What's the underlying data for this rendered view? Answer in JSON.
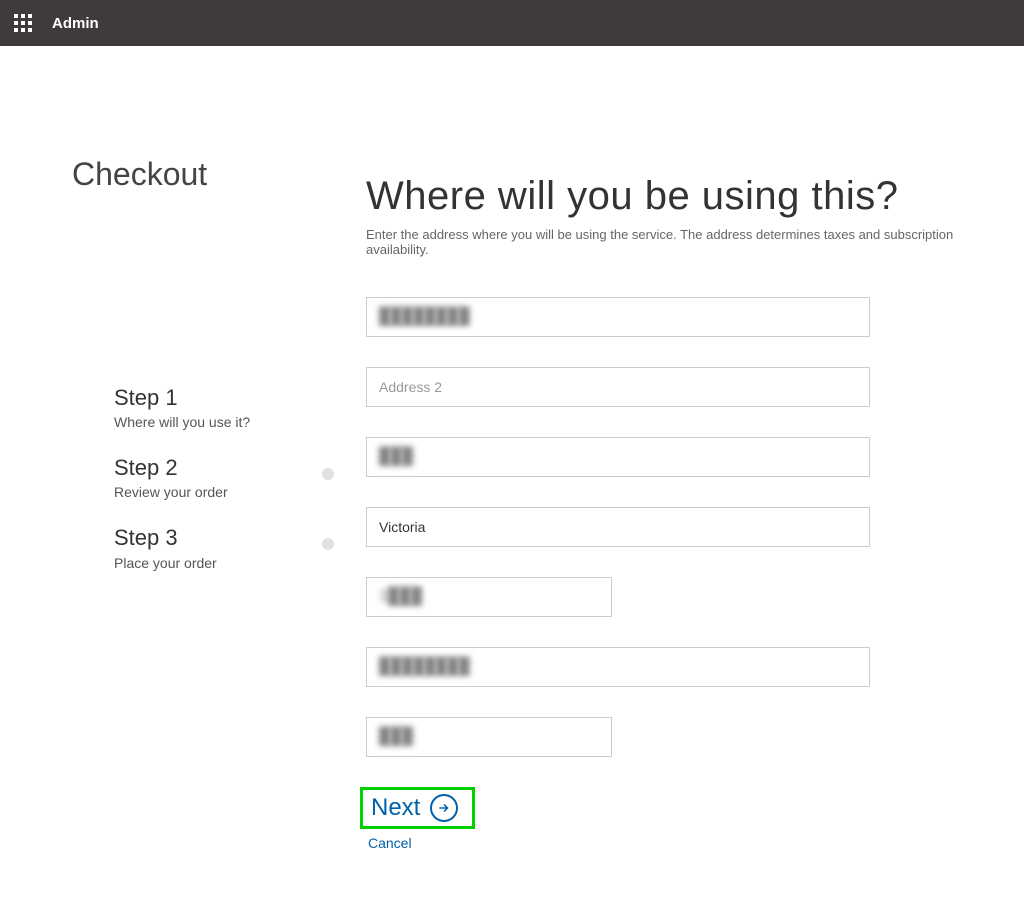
{
  "topbar": {
    "title": "Admin"
  },
  "checkout": {
    "heading": "Checkout"
  },
  "steps": [
    {
      "title": "Step 1",
      "sub": "Where will you use it?",
      "dot": false
    },
    {
      "title": "Step 2",
      "sub": "Review your order",
      "dot": true
    },
    {
      "title": "Step 3",
      "sub": "Place your order",
      "dot": true
    }
  ],
  "form": {
    "heading": "Where will you be using this?",
    "subtext": "Enter the address where you will be using the service. The address determines taxes and subscription availability.",
    "fields": {
      "address1": {
        "value": "████████"
      },
      "address2": {
        "placeholder": "Address 2",
        "value": ""
      },
      "city": {
        "value": "███"
      },
      "state": {
        "value": "Victoria"
      },
      "postal": {
        "value": "3███"
      },
      "extra1": {
        "value": "████████"
      },
      "extra2": {
        "value": "███"
      }
    }
  },
  "actions": {
    "next": "Next",
    "cancel": "Cancel"
  }
}
